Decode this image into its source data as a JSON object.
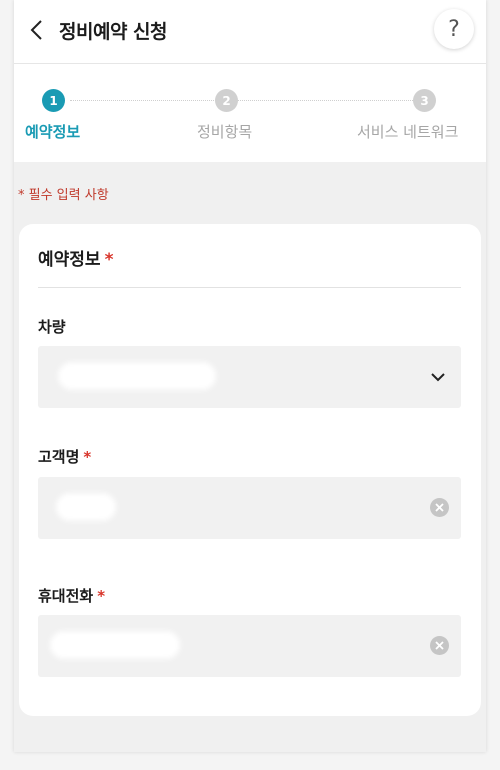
{
  "header": {
    "title": "정비예약 신청",
    "help_label": "?"
  },
  "stepper": {
    "steps": [
      {
        "number": "1",
        "label": "예약정보",
        "active": true
      },
      {
        "number": "2",
        "label": "정비항목",
        "active": false
      },
      {
        "number": "3",
        "label": "서비스 네트워크",
        "active": false
      }
    ]
  },
  "notice": {
    "required_text": "* 필수 입력 사항"
  },
  "form": {
    "section_title": "예약정보",
    "required_mark": "*",
    "fields": [
      {
        "label": "차량",
        "required": false,
        "control": "select"
      },
      {
        "label": "고객명",
        "required": true,
        "control": "text-clearable"
      },
      {
        "label": "휴대전화",
        "required": true,
        "control": "text-clearable"
      }
    ]
  },
  "colors": {
    "accent": "#1a9bb4",
    "inactive_step": "#d0d0d0",
    "required": "#d8342a",
    "field_bg": "#f1f1f1"
  },
  "icons": {
    "back": "chevron-left-icon",
    "help": "question-mark-icon",
    "dropdown": "chevron-down-icon",
    "clear": "clear-circle-icon"
  }
}
